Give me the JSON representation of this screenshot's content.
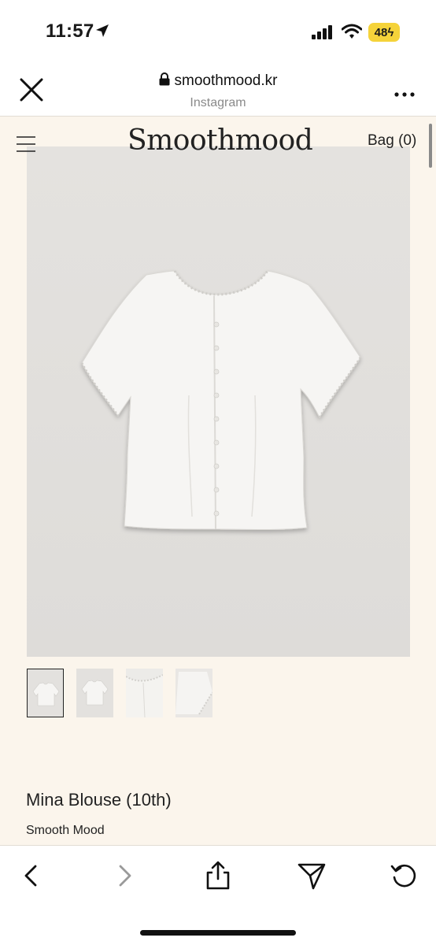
{
  "status_bar": {
    "time": "11:57",
    "battery": "48"
  },
  "browser": {
    "url": "smoothmood.kr",
    "source_label": "Instagram"
  },
  "site": {
    "logo_text": "Smoothmood",
    "bag_label": "Bag (0)"
  },
  "product": {
    "name": "Mina Blouse (10th)",
    "brand": "Smooth Mood",
    "thumbnails": [
      "front-view",
      "front-view",
      "detail-closeup",
      "sleeve-detail"
    ]
  },
  "toolbar": {
    "items": [
      "back",
      "forward",
      "share",
      "send",
      "reload"
    ]
  },
  "colors": {
    "page_background": "#fbf5ec",
    "image_background": "#e0dedb",
    "battery": "#f5d33a"
  }
}
